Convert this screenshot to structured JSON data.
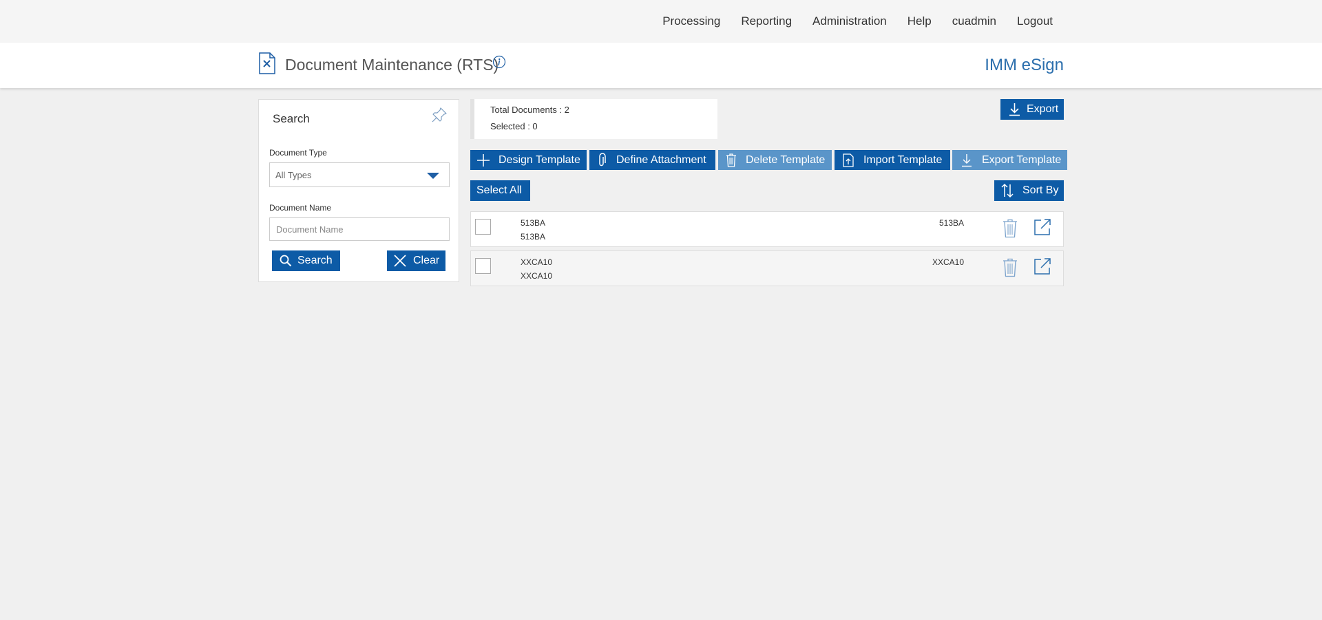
{
  "nav": {
    "items": [
      {
        "label": "Processing"
      },
      {
        "label": "Reporting"
      },
      {
        "label": "Administration"
      },
      {
        "label": "Help"
      },
      {
        "label": "cuadmin"
      },
      {
        "label": "Logout"
      }
    ]
  },
  "header": {
    "title": "Document Maintenance (RTS)",
    "brand": "IMM eSign"
  },
  "search": {
    "title": "Search",
    "doc_type_label": "Document Type",
    "doc_type_value": "All Types",
    "doc_name_label": "Document Name",
    "doc_name_placeholder": "Document Name",
    "doc_name_value": "",
    "search_label": "Search",
    "clear_label": "Clear"
  },
  "summary": {
    "total": "Total Documents : 2",
    "selected": "Selected : 0"
  },
  "toolbar": {
    "export_label": "Export",
    "design_label": "Design Template",
    "attach_label": "Define Attachment",
    "delete_label": "Delete Template",
    "import_label": "Import Template",
    "export_tpl_label": "Export Template",
    "select_all_label": "Select All",
    "sort_label": "Sort By"
  },
  "rows": [
    {
      "code": "513BA",
      "name": "513BA",
      "type": "513BA"
    },
    {
      "code": "XXCA10",
      "name": "XXCA10",
      "type": "XXCA10"
    }
  ],
  "colors": {
    "primary": "#0d5ba6",
    "primary_disabled": "#5a95c9",
    "brand": "#2c6fad",
    "row_alt": "#f5f5f5"
  },
  "icons": {
    "doc": "document-icon",
    "info": "info-icon",
    "pin": "pin-icon",
    "search": "search-icon",
    "clear": "close-icon",
    "export": "download-icon",
    "design": "plus-icon",
    "attach": "paperclip-icon",
    "delete": "trash-icon",
    "import": "upload-icon",
    "sort": "sort-icon",
    "open": "external-link-icon"
  }
}
